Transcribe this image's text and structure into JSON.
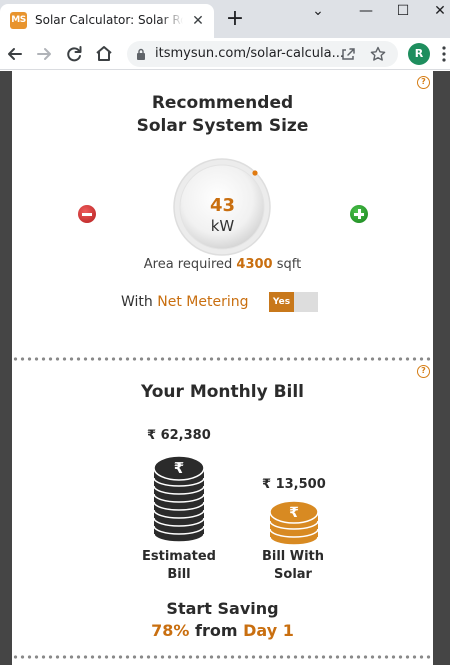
{
  "browser": {
    "tab_title": "Solar Calculator: Solar Rooftop",
    "favicon_text": "MS",
    "tab_close_glyph": "✕",
    "new_tab_glyph": "+",
    "url": "itsmysun.com/solar-calcula...",
    "profile_initial": "R",
    "window_controls": [
      "⌄",
      "—",
      "☐",
      "✕"
    ]
  },
  "system_size": {
    "title_line1": "Recommended",
    "title_line2": "Solar System Size",
    "help_glyph": "?",
    "value": "43",
    "unit": "kW",
    "area_prefix": "Area required",
    "area_value": "4300",
    "area_unit": "sqft",
    "metering_prefix": "With",
    "metering_highlight": "Net Metering",
    "toggle_label": "Yes"
  },
  "monthly_bill": {
    "title": "Your Monthly Bill",
    "help_glyph": "?",
    "estimated_amount": "₹ 62,380",
    "estimated_caption_line1": "Estimated",
    "estimated_caption_line2": "Bill",
    "solar_amount": "₹ 13,500",
    "solar_caption_line1": "Bill With",
    "solar_caption_line2": "Solar",
    "saving_line1": "Start Saving",
    "saving_percent": "78%",
    "saving_from": "from",
    "saving_day": "Day 1"
  },
  "colors": {
    "accent": "#c96f10",
    "toggle_on": "#c8781b",
    "dark_coins": "#2b2b2b",
    "solar_coins": "#d88a22",
    "page_background": "#454545"
  }
}
